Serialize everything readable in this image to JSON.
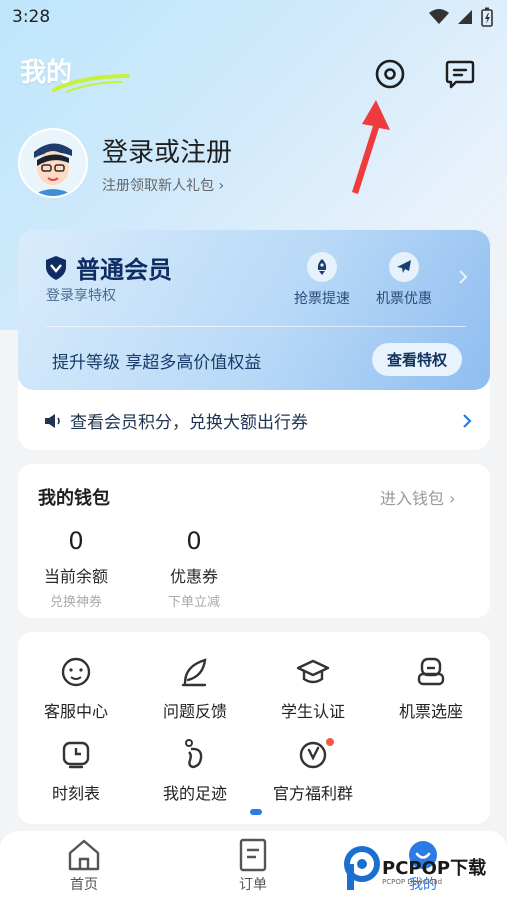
{
  "status_bar": {
    "time": "3:28"
  },
  "header": {
    "title": "我的"
  },
  "profile": {
    "title": "登录或注册",
    "subtitle": "注册领取新人礼包 ›"
  },
  "member": {
    "title": "普通会员",
    "subtitle": "登录享特权",
    "perks": [
      {
        "label": "抢票提速",
        "icon": "rocket-icon"
      },
      {
        "label": "机票优惠",
        "icon": "plane-icon"
      }
    ],
    "upgrade_text": "提升等级 享超多高价值权益",
    "privilege_button": "查看特权",
    "points_text": "查看会员积分，兑换大额出行券"
  },
  "wallet": {
    "title": "我的钱包",
    "link": "进入钱包 ›",
    "items": [
      {
        "value": "0",
        "label": "当前余额",
        "hint": "兑换神券"
      },
      {
        "value": "0",
        "label": "优惠券",
        "hint": "下单立减"
      }
    ]
  },
  "services": [
    {
      "label": "客服中心",
      "icon": "service-icon"
    },
    {
      "label": "问题反馈",
      "icon": "feedback-icon"
    },
    {
      "label": "学生认证",
      "icon": "graduation-cap-icon"
    },
    {
      "label": "机票选座",
      "icon": "seat-icon"
    },
    {
      "label": "时刻表",
      "icon": "clock-icon"
    },
    {
      "label": "我的足迹",
      "icon": "footprint-icon"
    },
    {
      "label": "官方福利群",
      "icon": "group-icon"
    }
  ],
  "tabs": [
    {
      "label": "首页"
    },
    {
      "label": "订单"
    },
    {
      "label": "我的"
    }
  ],
  "watermark": {
    "brand": "PCPOP下载",
    "sub": "PCPOP Download"
  },
  "colors": {
    "accent": "#2c7be5",
    "arrow": "#ef3b3b"
  }
}
